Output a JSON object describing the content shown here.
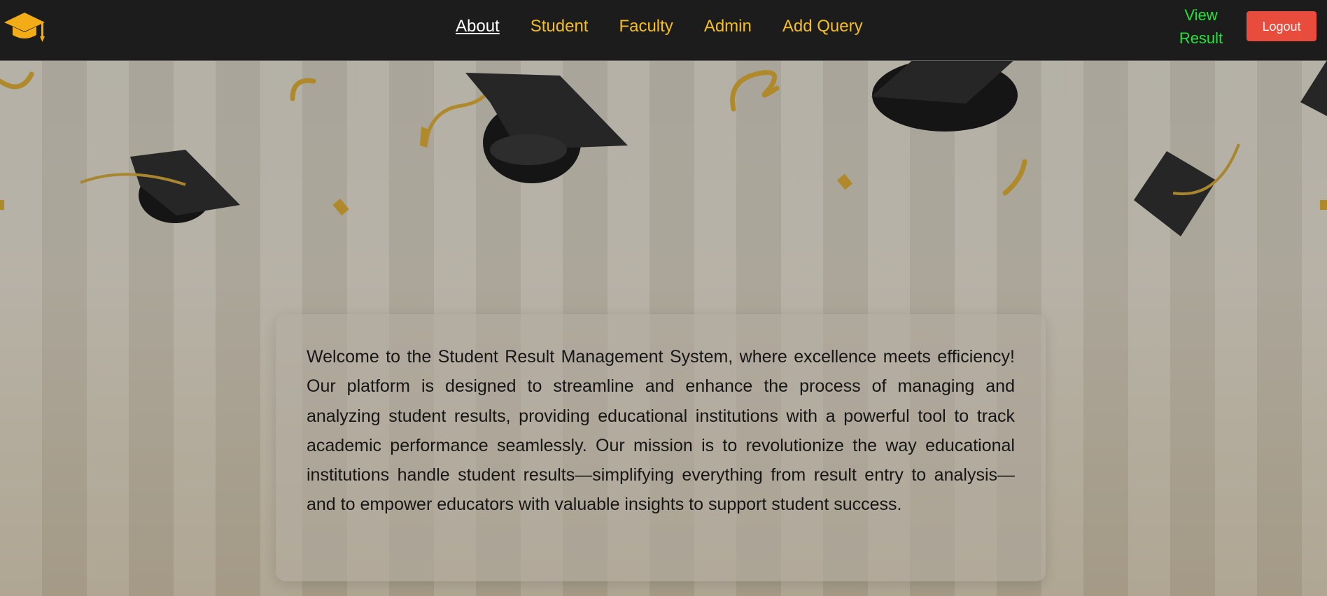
{
  "navbar": {
    "logo_icon": "graduation-cap-icon",
    "links": [
      {
        "label": "About",
        "active": true
      },
      {
        "label": "Student",
        "active": false
      },
      {
        "label": "Faculty",
        "active": false
      },
      {
        "label": "Admin",
        "active": false
      },
      {
        "label": "Add Query",
        "active": false
      }
    ],
    "view_result_line1": "View",
    "view_result_line2": "Result",
    "logout_label": "Logout"
  },
  "colors": {
    "navbar_bg": "#1c1c1c",
    "link": "#f5be1e",
    "active_link": "#ffffff",
    "view_result": "#22e33c",
    "logout_bg": "#e74c3c"
  },
  "hero": {
    "decoration": "graduation-caps-and-confetti-background"
  },
  "about": {
    "text": "Welcome to the Student Result Management System, where excellence meets efficiency! Our platform is designed to streamline and enhance the process of managing and analyzing student results, providing educational institutions with a powerful tool to track academic performance seamlessly. Our mission is to revolutionize the way educational institutions handle student results—simplifying everything from result entry to analysis—and to empower educators with valuable insights to support student success."
  }
}
